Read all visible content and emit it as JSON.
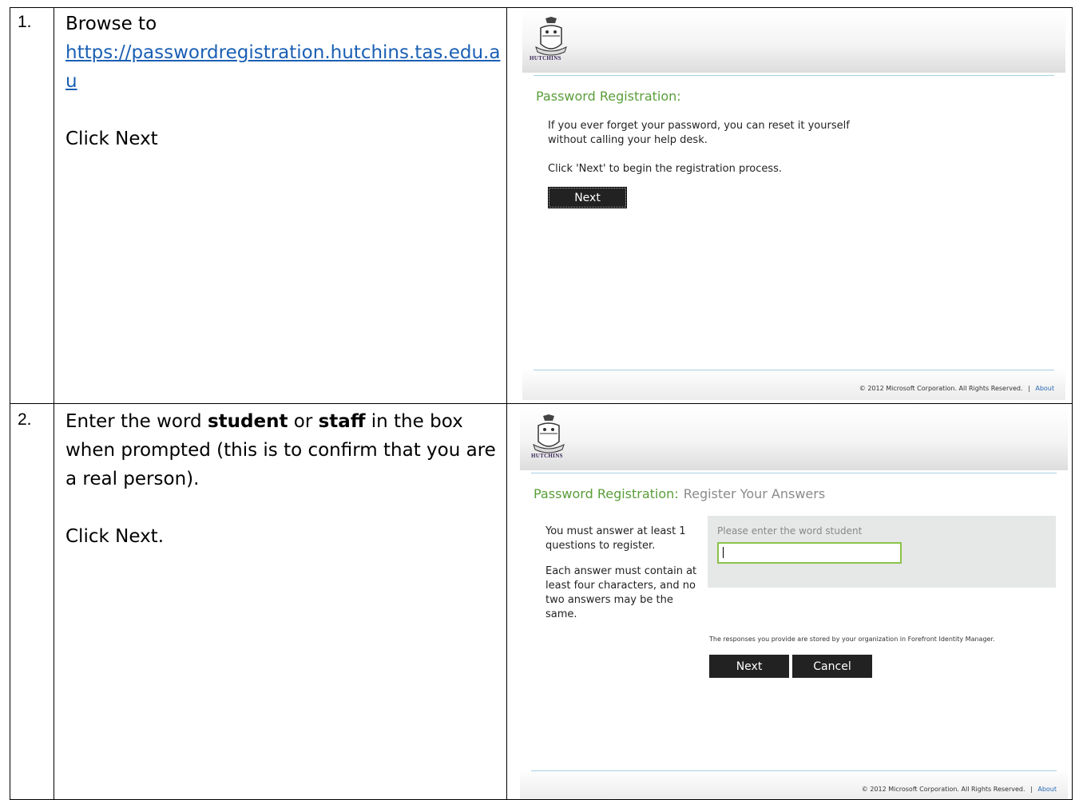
{
  "steps": [
    {
      "number": "1.",
      "instruction": {
        "browse_text": "Browse to",
        "url": "https://passwordregistration.hutchins.tas.edu.au",
        "action": "Click Next"
      },
      "screenshot": {
        "logo_text": "HUTCHINS",
        "title": "Password Registration:",
        "line1": "If you ever forget your password, you can reset it yourself",
        "line2": "without calling your help desk.",
        "line3": "Click 'Next' to begin the registration process.",
        "next_label": "Next",
        "copyright": "© 2012 Microsoft Corporation. All Rights Reserved.",
        "separator": "|",
        "about_label": "About"
      }
    },
    {
      "number": "2.",
      "instruction": {
        "pre": "Enter the word ",
        "bold1": "student",
        "mid": " or ",
        "bold2": "staff",
        "post": " in the box when prompted (this is to confirm that you are a real person).",
        "action": "Click Next."
      },
      "screenshot": {
        "logo_text": "HUTCHINS",
        "title": "Password Registration:",
        "subtitle": "Register Your Answers",
        "req1": "You must answer at least 1 questions to register.",
        "req2": "Each answer must contain at least four characters, and no two answers may be the same.",
        "question_label": "Please enter the word student",
        "answer_value": "",
        "storage_note": "The responses you provide are stored by your organization in Forefront Identity Manager.",
        "next_label": "Next",
        "cancel_label": "Cancel",
        "copyright": "© 2012 Microsoft Corporation. All Rights Reserved.",
        "separator": "|",
        "about_label": "About"
      }
    }
  ],
  "colors": {
    "title_green": "#5a9e3a",
    "link_blue": "#1a5fb4",
    "rule_blue": "#a8cfe4",
    "input_border": "#8bc34a"
  }
}
